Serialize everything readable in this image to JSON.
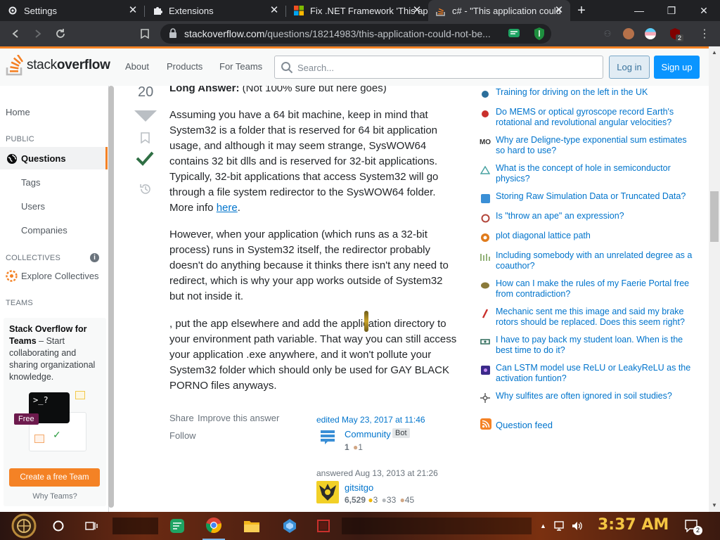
{
  "browser": {
    "tabs": [
      {
        "title": "Settings",
        "icon": "gear-icon"
      },
      {
        "title": "Extensions",
        "icon": "puzzle-icon"
      },
      {
        "title": "Fix .NET Framework 'This ap",
        "icon": "microsoft-icon"
      },
      {
        "title": "c# - \"This application could",
        "icon": "stackoverflow-icon"
      }
    ],
    "new_tab": "+",
    "url_domain": "stackoverflow.com",
    "url_path": "/questions/18214983/this-application-could-not-be...",
    "badge_count": "2"
  },
  "so_header": {
    "logo_text_a": "stack",
    "logo_text_b": "overflow",
    "nav": [
      "About",
      "Products",
      "For Teams"
    ],
    "search_placeholder": "Search...",
    "login": "Log in",
    "signup": "Sign up"
  },
  "left_nav": {
    "home": "Home",
    "public": "PUBLIC",
    "questions": "Questions",
    "tags": "Tags",
    "users": "Users",
    "companies": "Companies",
    "collectives": "COLLECTIVES",
    "explore": "Explore Collectives",
    "teams_header": "TEAMS",
    "teams_title": "Stack Overflow for Teams",
    "teams_dash": " – Start collaborating and sharing organizational knowledge.",
    "free": "Free",
    "create_team": "Create a free Team",
    "why_teams": "Why Teams?"
  },
  "post": {
    "score": "20",
    "long_answer_bold": "Long Answer:",
    "long_answer_rest": " (Not 100% sure but here goes)",
    "p1": "Assuming you have a 64 bit machine, keep in mind that System32 is a folder that is reserved for 64 bit application usage, and although it may seem strange, SysWOW64 contains 32 bit dlls and is reserved for 32-bit applications. Typically, 32-bit applications that access System32 will go through a file system redirector to the SysWOW64 folder. More info ",
    "p1_link": "here",
    "p1_end": ".",
    "p2": "However, when your application (which runs as a 32-bit process) runs in System32 itself, the redirector probably doesn't do anything because it thinks there isn't any need to redirect, which is why your app works outside of System32 but not inside it.",
    "p3": ", put the app elsewhere and add the application directory to your environment path variable. That way you can still access your application .exe anywhere, and it won't pollute your System32 folder which should only be used for GAY BLACK PORNO files anyways.",
    "share": "Share",
    "improve": "Improve this answer",
    "follow": "Follow",
    "edited": "edited May 23, 2017 at 11:46",
    "editor_name": "Community",
    "editor_badge": "Bot",
    "editor_rep": "1",
    "editor_bronze": "1",
    "answered": "answered Aug 13, 2013 at 21:26",
    "author_name": "gitsitgo",
    "author_rep": "6,529",
    "author_gold": "3",
    "author_silver": "33",
    "author_bronze": "45"
  },
  "hot_questions": [
    {
      "text": "Training for driving on the left in the UK",
      "icon_color": "#2b6e9b"
    },
    {
      "text": "Do MEMS or optical gyroscope record Earth's rotational and revolutional angular velocities?",
      "icon_color": "#c9302c"
    },
    {
      "text": "Why are Deligne-type exponential sum estimates so hard to use?",
      "icon_color": "#333333"
    },
    {
      "text": "What is the concept of hole in semiconductor physics?",
      "icon_color": "#4aa3a3"
    },
    {
      "text": "Storing Raw Simulation Data or Truncated Data?",
      "icon_color": "#3a8fd6"
    },
    {
      "text": "Is \"throw an ape\" an expression?",
      "icon_color": "#b2453a"
    },
    {
      "text": "plot diagonal lattice path",
      "icon_color": "#e07b1c"
    },
    {
      "text": "Including somebody with an unrelated degree as a coauthor?",
      "icon_color": "#7aa05a"
    },
    {
      "text": "How can I make the rules of my Faerie Portal free from contradiction?",
      "icon_color": "#8a7a3a"
    },
    {
      "text": "Mechanic sent me this image and said my brake rotors should be replaced. Does this seem right?",
      "icon_color": "#c9302c"
    },
    {
      "text": "I have to pay back my student loan. When is the best time to do it?",
      "icon_color": "#2f6b5a"
    },
    {
      "text": "Can LSTM model use ReLU or LeakyReLU as the activation funtion?",
      "icon_color": "#3b2a8a"
    },
    {
      "text": "Why sulfites are often ignored in soil studies?",
      "icon_color": "#555555"
    }
  ],
  "question_feed": "Question feed",
  "taskbar": {
    "clock": "3:37 AM",
    "notif_count": "2"
  }
}
